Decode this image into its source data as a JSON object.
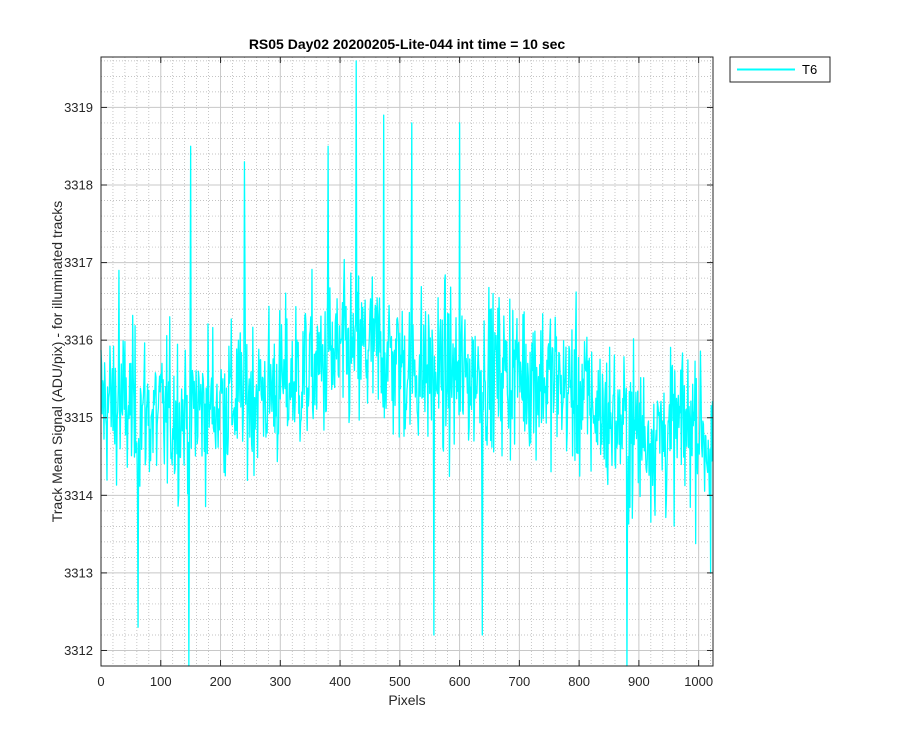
{
  "chart_data": {
    "type": "line",
    "title": "RS05 Day02 20200205-Lite-044 int time = 10 sec",
    "xlabel": "Pixels",
    "ylabel": "Track Mean Signal (ADU/pix) - for illuminated tracks",
    "xlim": [
      0,
      1024
    ],
    "ylim": [
      3311.8,
      3319.65
    ],
    "xticks": [
      0,
      100,
      200,
      300,
      400,
      500,
      600,
      700,
      800,
      900,
      1000
    ],
    "yticks": [
      3312,
      3313,
      3314,
      3315,
      3316,
      3317,
      3318,
      3319
    ],
    "grid": "major and minor",
    "legend_position": "outside top-right",
    "series": [
      {
        "name": "T6",
        "color": "#00ffff",
        "mean_profile": {
          "x": [
            0,
            100,
            200,
            300,
            350,
            400,
            450,
            500,
            550,
            600,
            650,
            700,
            750,
            800,
            850,
            900,
            950,
            1000,
            1023
          ],
          "y": [
            3315.2,
            3315.0,
            3315.2,
            3315.4,
            3315.6,
            3315.8,
            3315.9,
            3315.7,
            3315.6,
            3315.5,
            3315.6,
            3315.6,
            3315.5,
            3315.3,
            3315.0,
            3314.8,
            3314.8,
            3315.0,
            3314.5
          ]
        },
        "points": [
          {
            "x": 150,
            "y": 3318.5
          },
          {
            "x": 147,
            "y": 3311.8
          },
          {
            "x": 427,
            "y": 3319.6
          },
          {
            "x": 473,
            "y": 3318.9
          },
          {
            "x": 520,
            "y": 3318.8
          },
          {
            "x": 600,
            "y": 3318.8
          },
          {
            "x": 557,
            "y": 3312.2
          },
          {
            "x": 638,
            "y": 3312.2
          },
          {
            "x": 880,
            "y": 3311.8
          },
          {
            "x": 62,
            "y": 3312.3
          },
          {
            "x": 380,
            "y": 3318.5
          },
          {
            "x": 240,
            "y": 3318.3
          },
          {
            "x": 30,
            "y": 3316.9
          },
          {
            "x": 1020,
            "y": 3313.0
          }
        ],
        "noise_amplitude": 1.3,
        "n_points": 1024
      }
    ]
  }
}
